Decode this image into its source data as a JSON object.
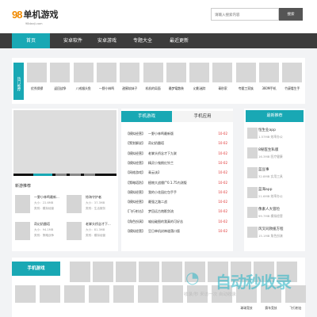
{
  "header": {
    "logo_badge": "98",
    "logo_name": "单机游戏",
    "logo_sub": "98danji.com",
    "search_placeholder": "请输入搜索内容",
    "search_button": "搜索"
  },
  "nav": [
    "首页",
    "安卓软件",
    "安卓游戏",
    "专题大全",
    "最近更新"
  ],
  "recommend": {
    "label": "热门推荐",
    "items": [
      "优秀保镖",
      "返回战争",
      "八戒猴头鱼",
      "一野小林鸣",
      "甜蜜软妹子",
      "机机的局面",
      "最梦竜散装",
      "幻影迷踪",
      "青秒家",
      "夸要工家族",
      "360M手机",
      "竹豪看生手"
    ]
  },
  "news": {
    "title": "新游推荐",
    "items": [
      {
        "title": "一野小林鸣最新...",
        "size": "大小：22.6MB",
        "type": "类别：模拟经营"
      },
      {
        "title": "惊海守护者",
        "size": "大小：37.3MB",
        "type": "类别：生活服务"
      },
      {
        "title": "奇幻奶酪塔",
        "size": "大小：94.1MB",
        "type": "类别：策略战争"
      },
      {
        "title": "老掌头桥念才下...",
        "size": "大小：81.3MB",
        "type": "类别：模拟经营"
      }
    ]
  },
  "tabs": {
    "active": "手机游戏",
    "inactive": "手机应用"
  },
  "list": [
    {
      "cat": "【模拟经营】",
      "name": "一野小林鸣最新版",
      "date": "10-02"
    },
    {
      "cat": "【策划解说】",
      "name": "奇幻奶酪塔",
      "date": "10-02"
    },
    {
      "cat": "【模拟经营】",
      "name": "老掌头桥念才下九联",
      "date": "10-02"
    },
    {
      "cat": "【模拟经营】",
      "name": "精灵小鬼桃红铃兰",
      "date": "10-02"
    },
    {
      "cat": "【网络游戏】",
      "name": "青云诀2",
      "date": "10-02"
    },
    {
      "cat": "【策略塔防】",
      "name": "植物大战僵尸0.1.75内测版",
      "date": "10-02"
    },
    {
      "cat": "【模拟经营】",
      "name": "我的小花园红包手手",
      "date": "10-02"
    },
    {
      "cat": "【模拟经营】",
      "name": "最强之路二战",
      "date": "10-02"
    },
    {
      "cat": "【飞行射击】",
      "name": "梦回远古炮影剑流",
      "date": "10-02"
    },
    {
      "cat": "【角色扮演】",
      "name": "喵仙破图的我真的可好苦",
      "date": "10-02"
    },
    {
      "cat": "【模拟经营】",
      "name": "豆日单机封神道落口版",
      "date": "10-02"
    }
  ],
  "ranking": {
    "title": "最新推荐",
    "items": [
      {
        "name": "恒生业app",
        "meta": "1.57MB  效率办公"
      },
      {
        "name": "8秘医生私版",
        "meta": "16.3MB  医疗健康"
      },
      {
        "name": "蓝豆事",
        "meta": "32.8MB  实用工具"
      },
      {
        "name": "蓝海app",
        "meta": "21.6MB  效率办公"
      },
      {
        "name": "像素人大冒险",
        "meta": "99.7MB  模拟经营"
      },
      {
        "name": "风叉同救援方程",
        "meta": "15.1MB  角色扮演"
      }
    ]
  },
  "games": {
    "title": "手机游戏",
    "items": [
      "",
      "",
      "",
      "",
      "",
      "",
      "",
      "",
      "",
      "",
      "",
      "球球竞技",
      "赛车竞技",
      "飞行射击"
    ]
  },
  "watermark": {
    "text": "自动秒收录",
    "sub": "收录/秒  来访一次  自动收录"
  },
  "colors": {
    "accent": "#19a8b4",
    "nav_bg": "#3c3c3c",
    "date": "#e03030"
  }
}
